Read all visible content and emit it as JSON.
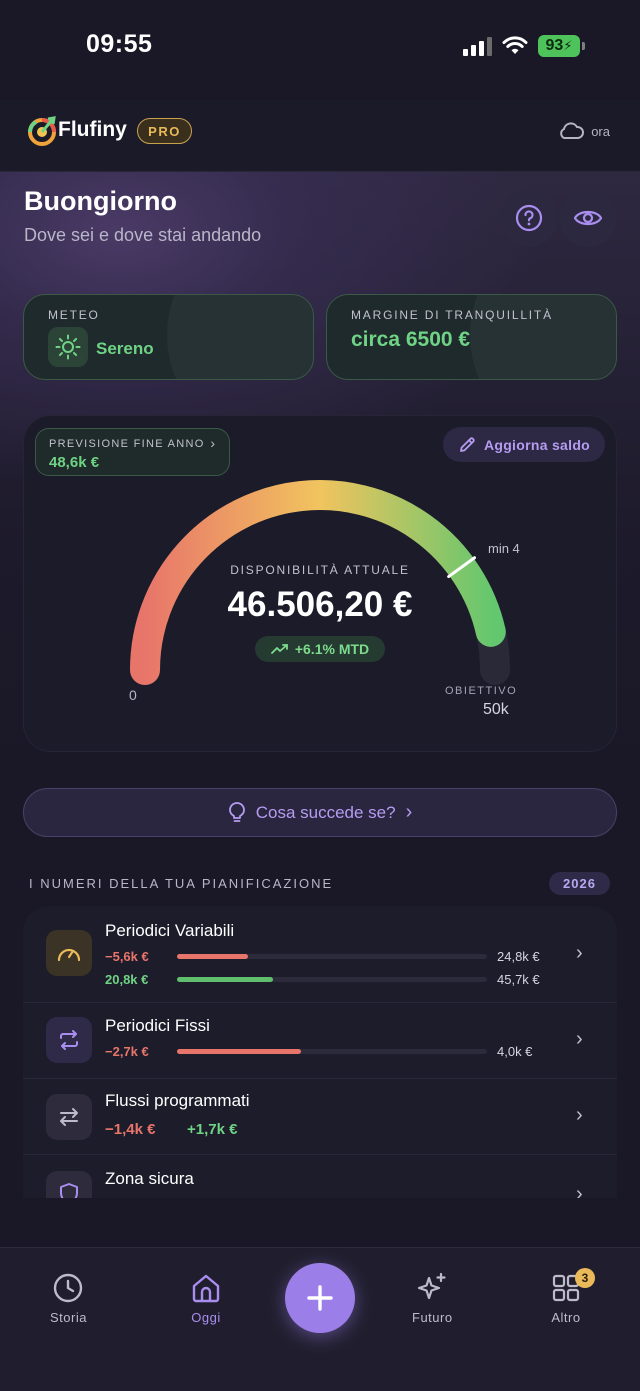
{
  "status_bar": {
    "time": "09:55",
    "battery": "93"
  },
  "header": {
    "app_name": "Flufiny",
    "badge": "PRO",
    "sync_label": "ora"
  },
  "greeting": {
    "title": "Buongiorno",
    "subtitle": "Dove sei e dove stai andando"
  },
  "cards": {
    "meteo": {
      "label": "METEO",
      "value": "Sereno"
    },
    "margin": {
      "label": "MARGINE DI TRANQUILLITÀ",
      "value": "circa 6500 €"
    }
  },
  "gauge": {
    "forecast_label": "PREVISIONE FINE ANNO",
    "forecast_value": "48,6k €",
    "update_label": "Aggiorna saldo",
    "center_label": "DISPONIBILITÀ ATTUALE",
    "value": "46.506,20 €",
    "delta": "+6.1% MTD",
    "min_label": "0",
    "marker_label": "min 4",
    "target_label": "OBIETTIVO",
    "target_value": "50k",
    "fill_fraction": 0.93,
    "marker_fraction": 0.8,
    "colors": {
      "start": "#e8756a",
      "mid": "#f1c45e",
      "end": "#62c76e"
    }
  },
  "whatif": {
    "label": "Cosa succede se?"
  },
  "planning": {
    "title": "I NUMERI DELLA TUA PIANIFICAZIONE",
    "year": "2026",
    "rows": [
      {
        "title": "Periodici Variabili",
        "icon": "speedometer-icon",
        "bars": [
          {
            "amount": "−5,6k €",
            "total": "24,8k €",
            "fraction": 0.23,
            "tone": "red"
          },
          {
            "amount": "20,8k €",
            "total": "45,7k €",
            "fraction": 0.31,
            "tone": "green"
          }
        ]
      },
      {
        "title": "Periodici Fissi",
        "icon": "repeat-icon",
        "bars": [
          {
            "amount": "−2,7k €",
            "total": "4,0k €",
            "fraction": 0.4,
            "tone": "red"
          }
        ]
      },
      {
        "title": "Flussi programmati",
        "icon": "transfer-arrows-icon",
        "out": "−1,4k €",
        "in": "+1,7k €"
      },
      {
        "title": "Zona sicura",
        "icon": "shield-icon"
      }
    ]
  },
  "nav": {
    "items": [
      {
        "label": "Storia",
        "icon": "clock-icon"
      },
      {
        "label": "Oggi",
        "icon": "home-icon"
      },
      {
        "label": "Futuro",
        "icon": "sparkles-icon"
      },
      {
        "label": "Altro",
        "icon": "grid-icon"
      }
    ],
    "notification_count": "3"
  }
}
